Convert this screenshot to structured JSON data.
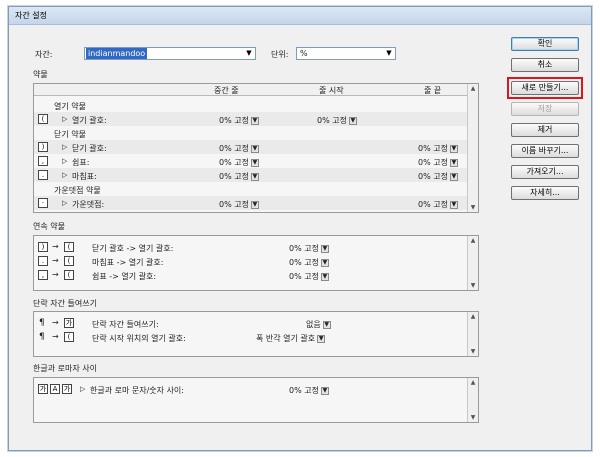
{
  "window": {
    "title": "자간 설정"
  },
  "top": {
    "kerning_label": "자간:",
    "kerning_value": "indianmandoo",
    "unit_label": "단위:",
    "unit_value": "%"
  },
  "sec1": {
    "title": "약물",
    "col_mid": "중간 줄",
    "col_start": "줄 시작",
    "col_end": "줄 끝",
    "group_open": "열기 약물",
    "row_open": {
      "icon": "(",
      "label": "열기 괄호:",
      "mid": "0% 고정",
      "start": "0% 고정"
    },
    "group_close": "닫기 약물",
    "row_close_paren": {
      "icon": ")",
      "label": "닫기 괄호:",
      "mid": "0% 고정",
      "end": "0% 고정"
    },
    "row_comma": {
      "icon": ",",
      "label": "쉼표:",
      "mid": "0% 고정",
      "end": "0% 고정"
    },
    "row_period": {
      "icon": ".",
      "label": "마침표:",
      "mid": "0% 고정",
      "end": "0% 고정"
    },
    "group_middot": "가운뎃점 약물",
    "row_middot": {
      "icon": "·",
      "label": "가운뎃점:",
      "mid": "0% 고정",
      "end": "0% 고정"
    }
  },
  "sec2": {
    "title": "연속 약물",
    "rows": [
      {
        "a": ")",
        "b": "(",
        "label": "닫기 괄호 -> 열기 괄호:",
        "value": "0% 고정"
      },
      {
        "a": ".",
        "b": "(",
        "label": "마침표 -> 열기 괄호:",
        "value": "0% 고정"
      },
      {
        "a": ",",
        "b": "(",
        "label": "쉼표 -> 열기 괄호:",
        "value": "0% 고정"
      }
    ],
    "arrow": "→"
  },
  "sec3": {
    "title": "단락 자간 들여쓰기",
    "rows": [
      {
        "a": "¶",
        "b": "가",
        "label": "단락 자간 들여쓰기:",
        "value": "없음"
      },
      {
        "a": "¶",
        "b": "(",
        "label": "단락 시작 위치의 열기 괄호:",
        "value": "폭 반각 열기 괄호"
      }
    ],
    "arrow": "→"
  },
  "sec4": {
    "title": "한글과 로마자 사이",
    "icons": [
      "가",
      "A",
      "가"
    ],
    "label": "한글과 로마 문자/숫자 사이:",
    "value": "0% 고정"
  },
  "buttons": {
    "ok": "확인",
    "cancel": "취소",
    "new": "새로 만들기...",
    "save": "저장",
    "remove": "제거",
    "rename": "이름 바꾸기...",
    "import": "가져오기...",
    "details": "자세히..."
  },
  "colors": {
    "highlight": "#e0141e",
    "selection": "#3169c6"
  }
}
